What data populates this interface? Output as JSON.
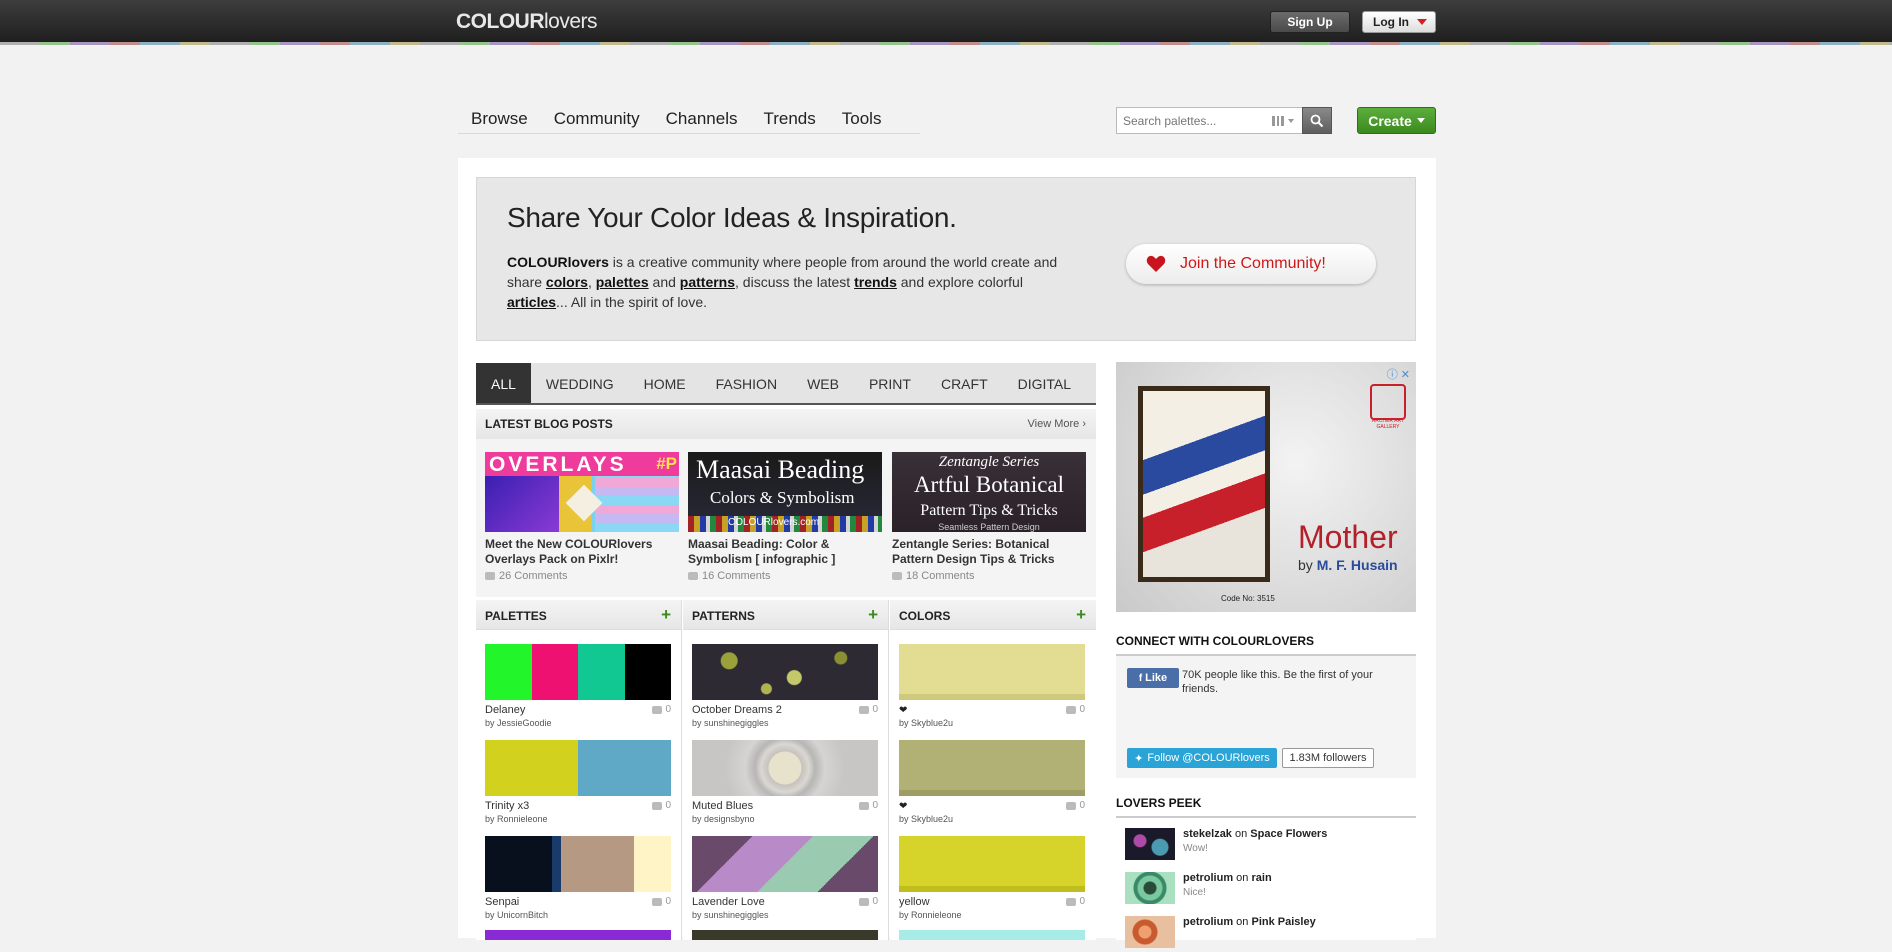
{
  "header": {
    "logo_bold": "COLOUR",
    "logo_rest": "lovers",
    "signup_label": "Sign Up",
    "login_label": "Log In"
  },
  "nav": {
    "items": [
      "Browse",
      "Community",
      "Channels",
      "Trends",
      "Tools"
    ],
    "search_placeholder": "Search palettes...",
    "create_label": "Create"
  },
  "hero": {
    "title": "Share Your Color Ideas & Inspiration.",
    "brand": "COLOURlovers",
    "text1": " is a creative community where people from around the world create and share ",
    "colors": "colors",
    "comma1": ", ",
    "palettes": "palettes",
    "and1": " and ",
    "patterns": "patterns",
    "text2": ", discuss the latest ",
    "trends": "trends",
    "text3": " and explore colorful ",
    "articles": "articles",
    "text4": "... All in the spirit of love.",
    "join_label": "Join the Community!"
  },
  "tabs": [
    "ALL",
    "WEDDING",
    "HOME",
    "FASHION",
    "WEB",
    "PRINT",
    "CRAFT",
    "DIGITAL ART"
  ],
  "blog": {
    "heading": "LATEST BLOG POSTS",
    "view_more": "View More ›",
    "posts": [
      {
        "title": "Meet the New COLOURlovers Overlays Pack on Pixlr!",
        "comments": "26 Comments",
        "img_text": "OVERLAYS",
        "img_text2": "#P"
      },
      {
        "title": "Maasai Beading: Color & Symbolism [ infographic ]",
        "comments": "16 Comments",
        "img_text": "Maasai Beading",
        "img_text2": "Colors & Symbolism",
        "img_text3": "COLOURlovers.com"
      },
      {
        "title": "Zentangle Series: Botanical Pattern Design Tips & Tricks",
        "comments": "18 Comments",
        "img_text": "Zentangle Series",
        "img_text2": "Artful Botanical",
        "img_text3": "Pattern Tips & Tricks",
        "img_text4": "Seamless Pattern Design"
      }
    ]
  },
  "columns": {
    "palettes": {
      "heading": "PALETTES",
      "items": [
        {
          "name": "Delaney",
          "by": "by  JessieGoodie",
          "comments": "0",
          "colors": [
            "#22f52a",
            "#ef1172",
            "#11c893",
            "#000000"
          ]
        },
        {
          "name": "Trinity x3",
          "by": "by  Ronnieleone",
          "comments": "0",
          "colors": [
            "#d2d21e",
            "#5fa8c6"
          ]
        },
        {
          "name": "Senpai",
          "by": "by  UnicornBitch",
          "comments": "0",
          "colors": [
            "#08101e",
            "#1a3a6a",
            "#b69982",
            "#fff4c6"
          ]
        }
      ]
    },
    "patterns": {
      "heading": "PATTERNS",
      "items": [
        {
          "name": "October Dreams 2",
          "by": "by  sunshinegiggles",
          "comments": "0"
        },
        {
          "name": "Muted Blues",
          "by": "by  designsbyno",
          "comments": "0"
        },
        {
          "name": "Lavender Love",
          "by": "by  sunshinegiggles",
          "comments": "0"
        }
      ]
    },
    "colors": {
      "heading": "COLORS",
      "items": [
        {
          "name": "",
          "by": "by  Skyblue2u",
          "comments": "0",
          "color": "#e2dd92"
        },
        {
          "name": "",
          "by": "by  Skyblue2u",
          "comments": "0",
          "color": "#b1b176"
        },
        {
          "name": "yellow",
          "by": "by  Ronnieleone",
          "comments": "0",
          "color": "#d6d32a"
        }
      ]
    }
  },
  "ad": {
    "title": "Mother",
    "by": "by ",
    "artist": "M. F. Husain",
    "code": "Code No: 3515",
    "gallery": "ARCHER ART GALLERY"
  },
  "connect": {
    "heading": "CONNECT WITH COLOURLOVERS",
    "fb_like": "Like",
    "fb_text": "70K people like this. Be the first of your friends.",
    "tw_follow": "Follow @COLOURlovers",
    "tw_count": "1.83M followers"
  },
  "peek": {
    "heading": "LOVERS PEEK",
    "items": [
      {
        "user": "stekelzak",
        "on": " on ",
        "target": "Space Flowers",
        "comment": "Wow!"
      },
      {
        "user": "petrolium",
        "on": " on ",
        "target": "rain",
        "comment": "Nice!"
      },
      {
        "user": "petrolium",
        "on": " on ",
        "target": "Pink Paisley",
        "comment": ""
      }
    ]
  }
}
